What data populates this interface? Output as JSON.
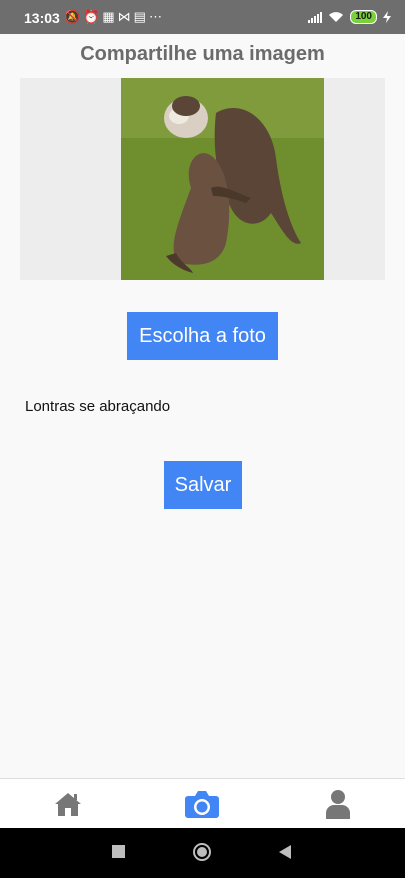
{
  "status_bar": {
    "time": "13:03",
    "battery": "100"
  },
  "header": {
    "title": "Compartilhe uma imagem"
  },
  "main": {
    "image_alt": "otters hugging photo",
    "choose_button_label": "Escolha a foto",
    "caption": "Lontras se abraçando",
    "save_button_label": "Salvar"
  },
  "bottom_nav": {
    "items": [
      {
        "icon": "home-icon",
        "active": false
      },
      {
        "icon": "camera-icon",
        "active": true
      },
      {
        "icon": "user-icon",
        "active": false
      }
    ],
    "active_color": "#4285f4",
    "inactive_color": "#777777"
  },
  "colors": {
    "accent": "#4285f4",
    "status_bar": "#6e6e6e",
    "background": "#f9f9f9"
  }
}
